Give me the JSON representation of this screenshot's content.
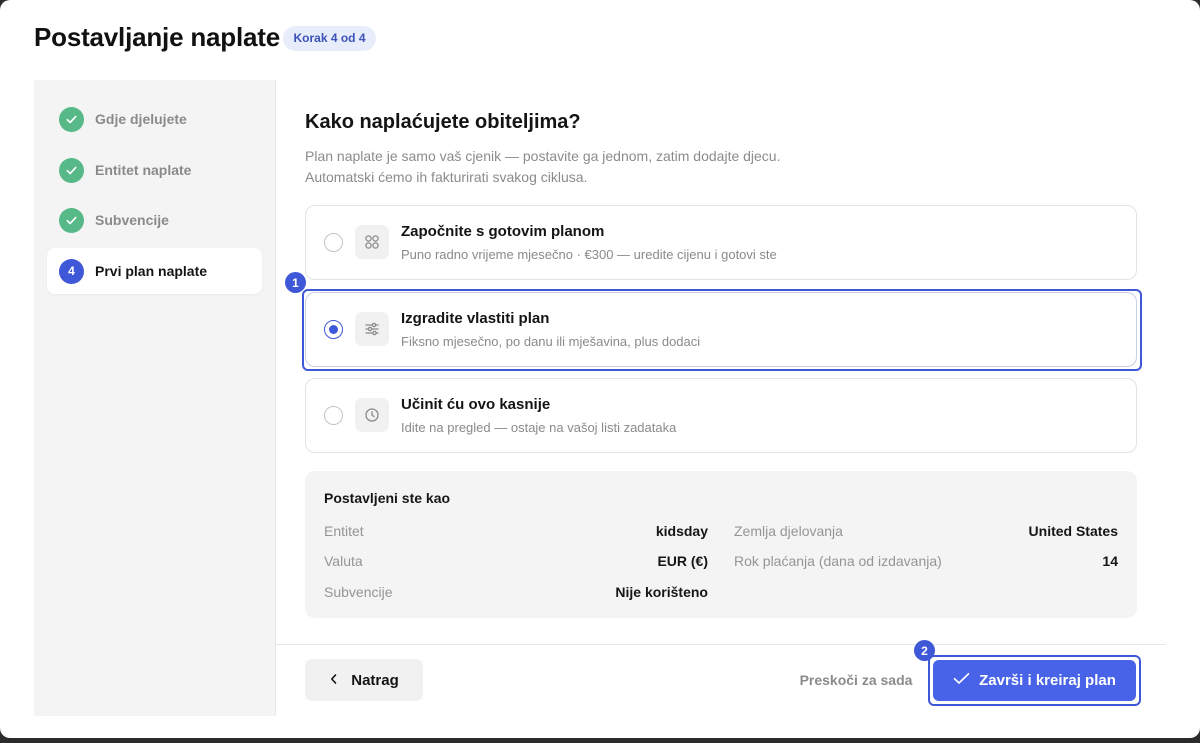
{
  "modal": {
    "title": "Postavljanje naplate",
    "step_badge": "Korak 4 od 4"
  },
  "sidebar": {
    "steps": [
      {
        "number": "",
        "label": "Gdje djelujete",
        "status": "done"
      },
      {
        "number": "",
        "label": "Entitet naplate",
        "status": "done"
      },
      {
        "number": "",
        "label": "Subvencije",
        "status": "done"
      },
      {
        "number": "4",
        "label": "Prvi plan naplate",
        "status": "current"
      }
    ]
  },
  "main": {
    "heading": "Kako naplaćujete obiteljima?",
    "subtitle_line1": "Plan naplate je samo vaš cjenik — postavite ga jednom, zatim dodajte djecu.",
    "subtitle_line2": "Automatski ćemo ih fakturirati svakog ciklusa.",
    "options": [
      {
        "title": "Započnite s gotovim planom",
        "description": "Puno radno vrijeme mjesečno · €300 — uredite cijenu i gotovi ste",
        "icon": "grid-icon",
        "selected": false
      },
      {
        "title": "Izgradite vlastiti plan",
        "description": "Fiksno mjesečno, po danu ili mješavina, plus dodaci",
        "icon": "sliders-icon",
        "selected": true
      },
      {
        "title": "Učinit ću ovo kasnije",
        "description": "Idite na pregled — ostaje na vašoj listi zadataka",
        "icon": "clock-icon",
        "selected": false
      }
    ]
  },
  "annotations": {
    "marker1": "1",
    "marker2": "2"
  },
  "summary": {
    "title": "Postavljeni ste kao",
    "left": [
      {
        "label": "Entitet",
        "value": "kidsday"
      },
      {
        "label": "Valuta",
        "value": "EUR (€)"
      },
      {
        "label": "Subvencije",
        "value": "Nije korišteno"
      }
    ],
    "right": [
      {
        "label": "Zemlja djelovanja",
        "value": "United States"
      },
      {
        "label": "Rok plaćanja (dana od izdavanja)",
        "value": "14"
      }
    ]
  },
  "footer": {
    "back_label": "Natrag",
    "skip_label": "Preskoči za sada",
    "finish_label": "Završi i kreiraj plan"
  },
  "colors": {
    "accent": "#3f58d8",
    "success": "#56b987",
    "primary_button": "#4862e8"
  }
}
